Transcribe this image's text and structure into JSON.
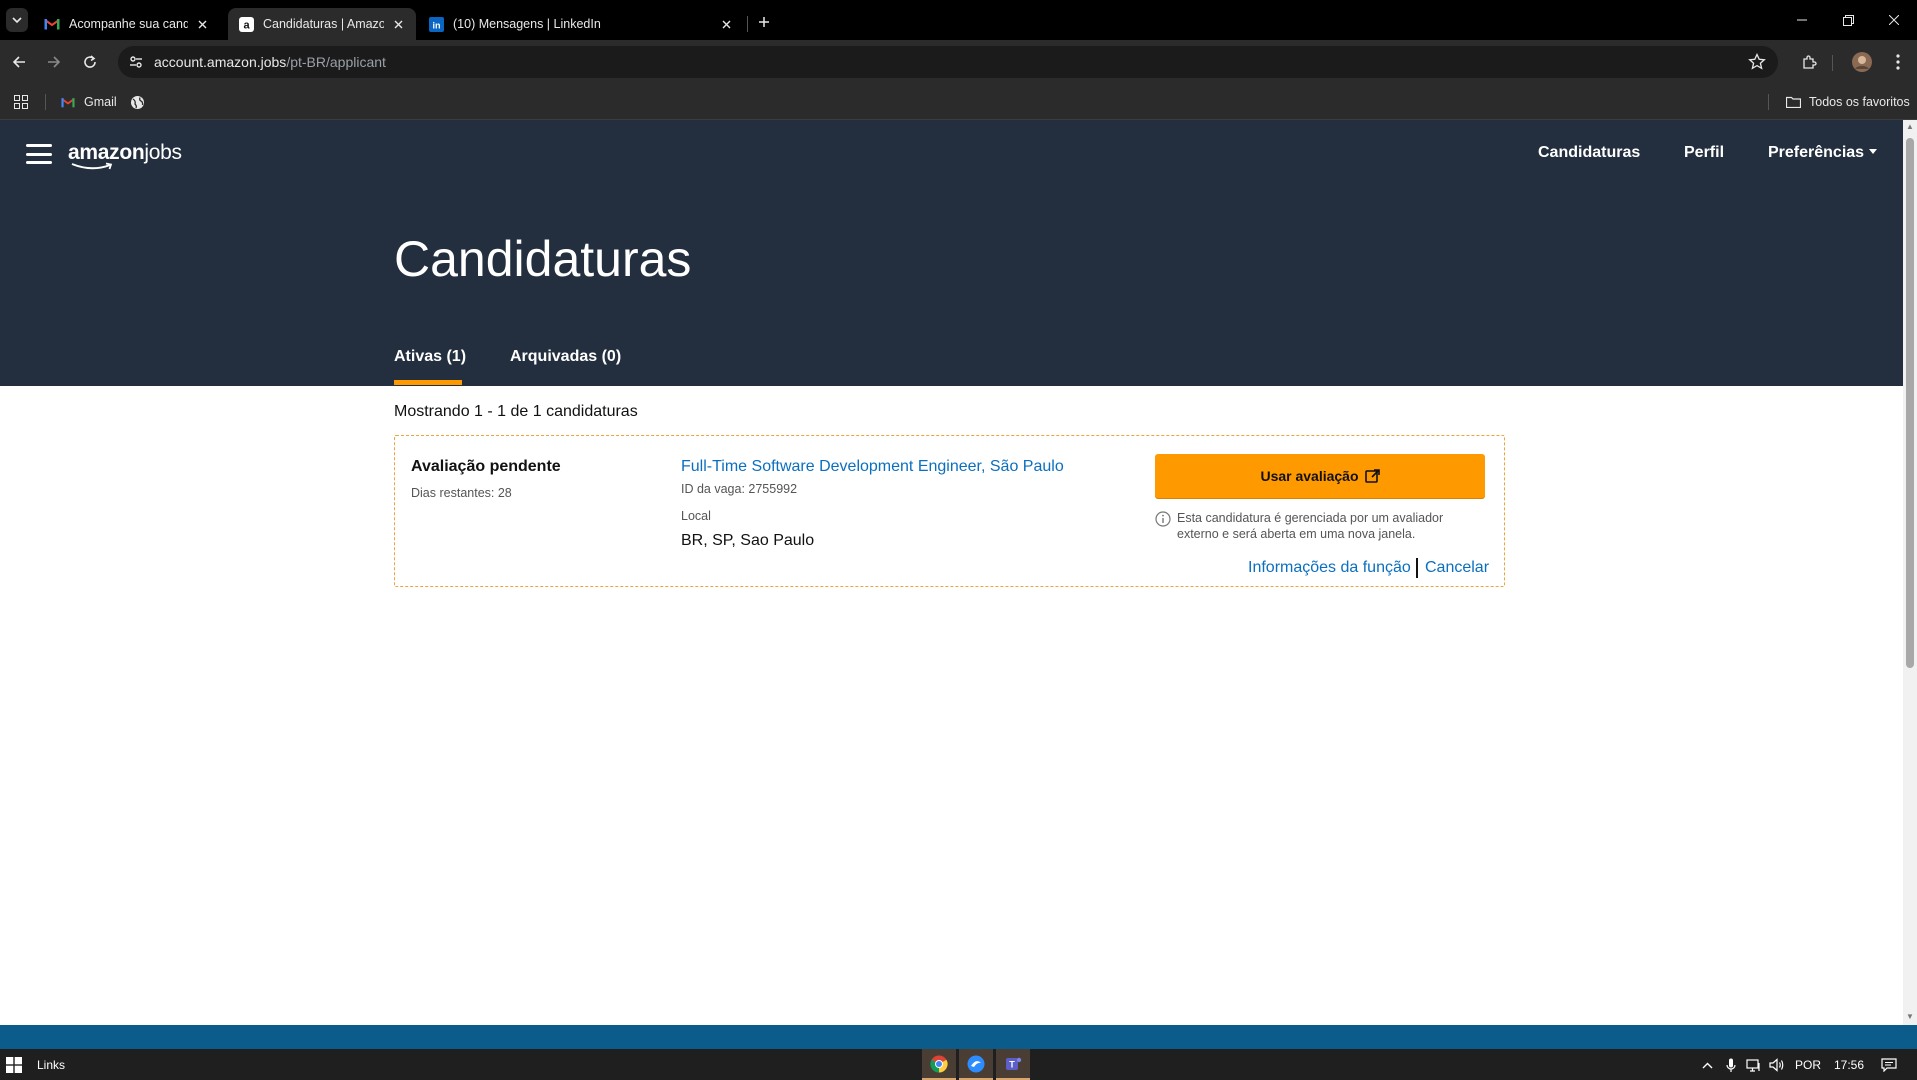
{
  "browser": {
    "tabs": [
      {
        "title": "Acompanhe sua candidatura - r",
        "favicon": "gmail-icon",
        "active": false
      },
      {
        "title": "Candidaturas | Amazon.jobs",
        "favicon": "amazon-icon",
        "active": true
      },
      {
        "title": "(10) Mensagens | LinkedIn",
        "favicon": "linkedin-icon",
        "active": false
      }
    ],
    "url_host": "account.amazon.jobs",
    "url_path": "/pt-BR/applicant",
    "bookmarks": [
      {
        "label": "Gmail",
        "icon": "gmail-icon"
      }
    ],
    "all_bookmarks_label": "Todos os favoritos"
  },
  "site": {
    "logo_bold": "amazon",
    "logo_light": "jobs",
    "nav": {
      "applications": "Candidaturas",
      "profile": "Perfil",
      "preferences": "Preferências"
    }
  },
  "hero": {
    "title": "Candidaturas",
    "tabs": {
      "active": "Ativas (1)",
      "archived": "Arquivadas (0)"
    }
  },
  "results": {
    "summary": "Mostrando 1 - 1 de 1 candidaturas"
  },
  "application": {
    "status": "Avaliação pendente",
    "days_left": "Dias restantes: 28",
    "job_title": "Full-Time Software Development Engineer, São Paulo",
    "job_id": "ID da vaga: 2755992",
    "location_label": "Local",
    "location": "BR, SP, Sao Paulo",
    "assessment_button": "Usar avaliação",
    "info_text": "Esta candidatura é gerenciada por um avaliador externo e será aberta em uma nova janela.",
    "job_info_link": "Informações da função",
    "cancel_link": "Cancelar"
  },
  "taskbar": {
    "links_label": "Links",
    "language": "POR",
    "time": "17:56"
  },
  "colors": {
    "nav_bg": "#232f3e",
    "accent": "#ff9900",
    "link": "#0b6fbf",
    "footer": "#0b5c8b"
  }
}
